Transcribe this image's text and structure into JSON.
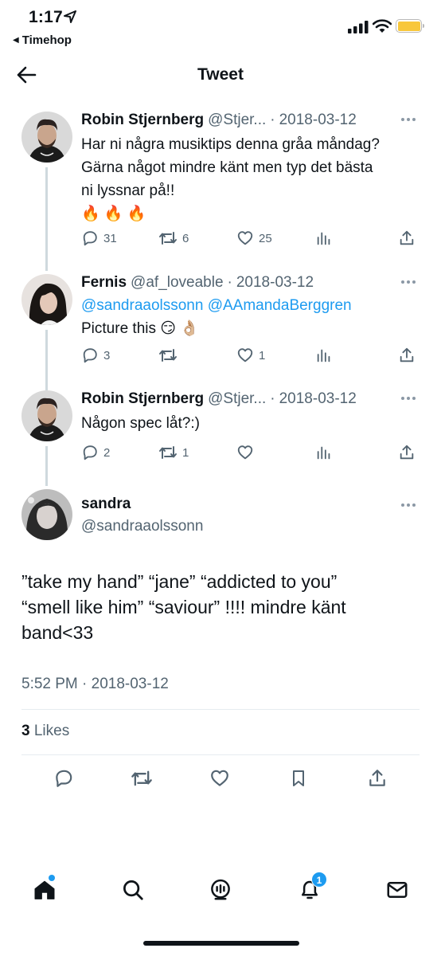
{
  "status_bar": {
    "time": "1:17",
    "back_app": "Timehop",
    "battery_color": "#f8c73b"
  },
  "header": {
    "title": "Tweet"
  },
  "thread": [
    {
      "name": "Robin Stjernberg",
      "handle": "@Stjer...",
      "date": "2018-03-12",
      "lines": [
        "Har ni några musiktips denna gråa måndag?",
        "Gärna något mindre känt men typ det bästa",
        "ni lyssnar på!!",
        "🔥 🔥 🔥"
      ],
      "replies": "31",
      "retweets": "6",
      "likes": "25"
    },
    {
      "name": "Fernis",
      "handle": "@af_loveable",
      "date": "2018-03-12",
      "mentions": "@sandraaolssonn @AAmandaBerggren",
      "text": "Picture this 😏 👌🏼",
      "replies": "3",
      "retweets": "",
      "likes": "1"
    },
    {
      "name": "Robin Stjernberg",
      "handle": "@Stjer...",
      "date": "2018-03-12",
      "text": "Någon spec låt?:)",
      "replies": "2",
      "retweets": "1",
      "likes": ""
    }
  ],
  "main_tweet": {
    "name": "sandra",
    "handle": "@sandraaolssonn",
    "lines": [
      "”take my hand” “jane” “addicted to you”",
      "“smell like him” “saviour” !!!! mindre känt",
      "band<33"
    ],
    "timestamp": "5:52 PM · 2018-03-12",
    "likes_count": "3",
    "likes_label": "Likes"
  },
  "action_icons": [
    "reply-icon",
    "retweet-icon",
    "like-icon",
    "views-icon",
    "share-icon"
  ],
  "main_action_icons": [
    "reply-icon",
    "retweet-icon",
    "like-icon",
    "bookmark-icon",
    "share-icon"
  ],
  "bottom_nav": {
    "items": [
      "home-icon",
      "search-icon",
      "spaces-icon",
      "notifications-icon",
      "messages-icon"
    ],
    "notifications_badge": "1"
  },
  "colors": {
    "accent": "#1d9bf0",
    "secondary_text": "#536471",
    "primary_text": "#0f1419"
  }
}
